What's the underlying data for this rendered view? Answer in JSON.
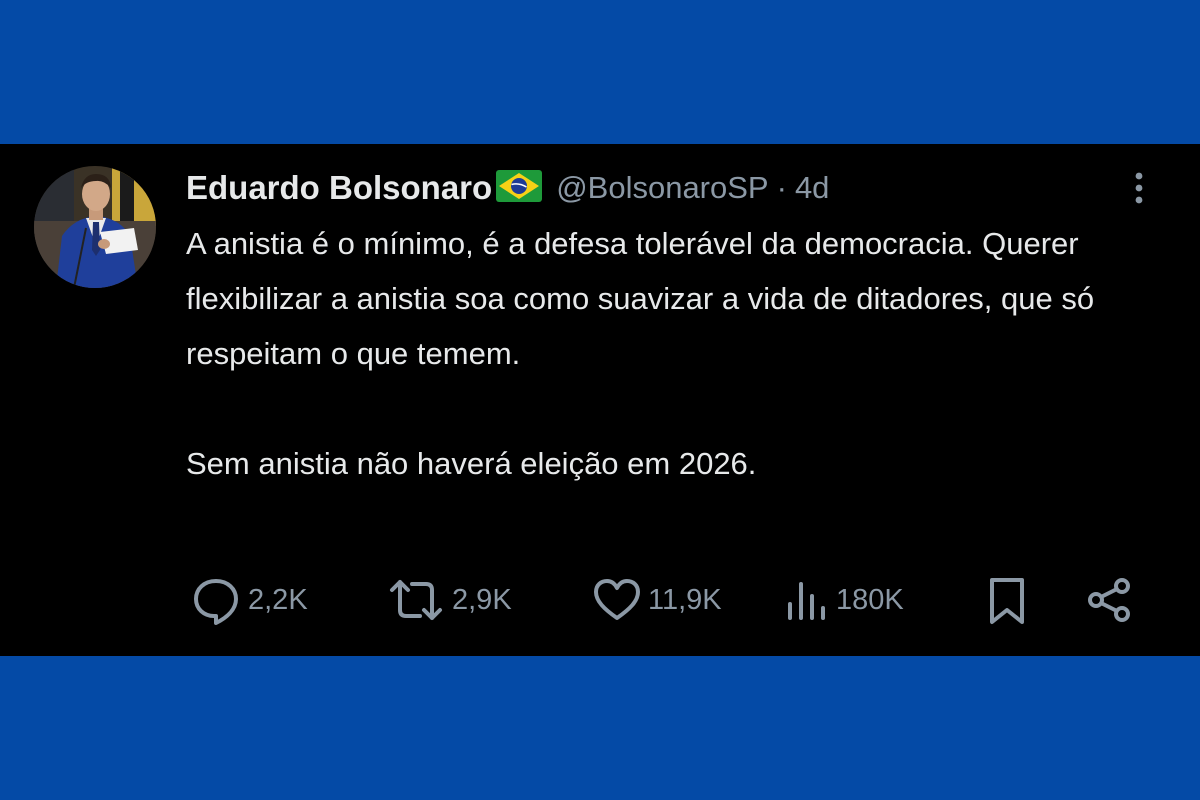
{
  "tweet": {
    "author_name": "Eduardo Bolsonaro",
    "author_flag_emoji": "🇧🇷",
    "handle": "@BolsonaroSP",
    "separator": "·",
    "time_ago": "4d",
    "paragraphs": [
      "A anistia é o mínimo, é a defesa tolerável da democracia. Querer flexibilizar a anistia soa como suavizar a vida de ditadores, que só respeitam o que temem.",
      "Sem anistia não haverá eleição em 2026."
    ],
    "stats": {
      "replies": "2,2K",
      "reposts": "2,9K",
      "likes": "11,9K",
      "views": "180K"
    }
  },
  "icons": {
    "more": "more-vertical-icon",
    "reply": "reply-bubble-icon",
    "repost": "repost-icon",
    "like": "heart-icon",
    "views": "views-bar-chart-icon",
    "bookmark": "bookmark-icon",
    "share": "share-icon"
  },
  "colors": {
    "frame_band": "#044aa6",
    "card_background": "#000000",
    "primary_text": "#e7e9ea",
    "secondary_text": "#8b98a5"
  }
}
